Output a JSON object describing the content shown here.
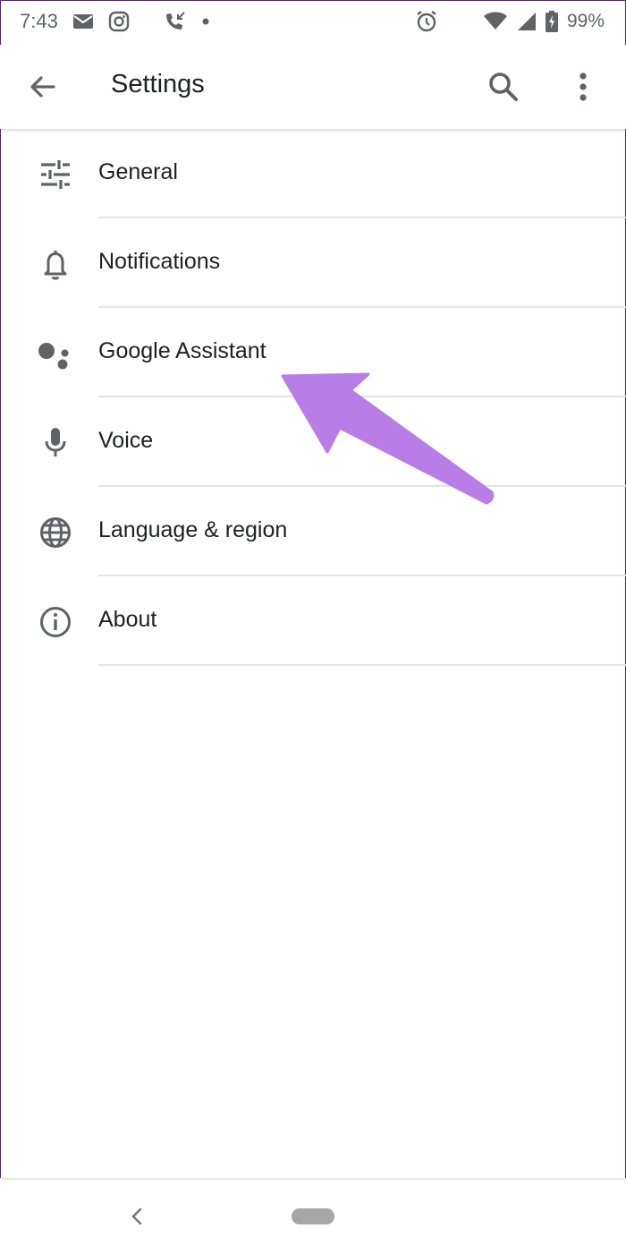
{
  "status_bar": {
    "time": "7:43",
    "battery": "99%",
    "icons": [
      "email-icon",
      "instagram-icon",
      "missed-call-icon",
      "notification-dot-icon",
      "alarm-icon",
      "wifi-icon",
      "signal-icon",
      "battery-charging-icon"
    ]
  },
  "app_bar": {
    "title": "Settings",
    "icons": [
      "back-arrow-icon",
      "search-icon",
      "more-vert-icon"
    ]
  },
  "settings": {
    "items": [
      {
        "label": "General",
        "icon": "tune-icon"
      },
      {
        "label": "Notifications",
        "icon": "bell-icon"
      },
      {
        "label": "Google Assistant",
        "icon": "assistant-icon"
      },
      {
        "label": "Voice",
        "icon": "mic-icon"
      },
      {
        "label": "Language & region",
        "icon": "globe-icon"
      },
      {
        "label": "About",
        "icon": "info-icon"
      }
    ]
  },
  "annotation": {
    "arrow_color": "#b87de6",
    "points_to": "Google Assistant"
  },
  "colors": {
    "icon_gray": "#5f6368",
    "text": "#202124",
    "divider": "#e4e4e4"
  }
}
